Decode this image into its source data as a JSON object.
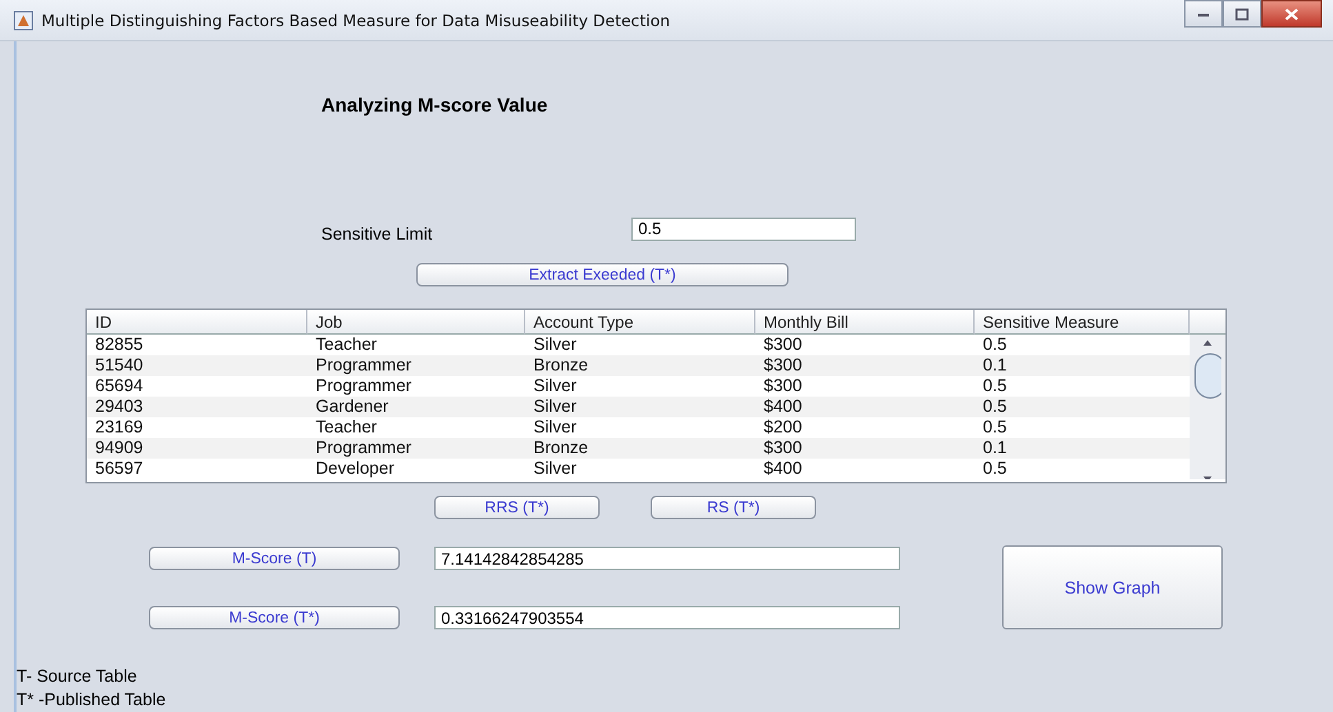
{
  "window": {
    "title": "Multiple Distinguishing Factors Based Measure for Data Misuseability Detection"
  },
  "heading": "Analyzing M-score Value",
  "sensitive_limit": {
    "label": "Sensitive Limit",
    "value": "0.5"
  },
  "extract_button": "Extract Exeeded (T*)",
  "table": {
    "columns": [
      "ID",
      "Job",
      "Account Type",
      "Monthly Bill",
      "Sensitive Measure"
    ],
    "rows": [
      [
        "82855",
        "Teacher",
        "Silver",
        "$300",
        "0.5"
      ],
      [
        "51540",
        "Programmer",
        "Bronze",
        "$300",
        "0.1"
      ],
      [
        "65694",
        "Programmer",
        "Silver",
        "$300",
        "0.5"
      ],
      [
        "29403",
        "Gardener",
        "Silver",
        "$400",
        "0.5"
      ],
      [
        "23169",
        "Teacher",
        "Silver",
        "$200",
        "0.5"
      ],
      [
        "94909",
        "Programmer",
        "Bronze",
        "$300",
        "0.1"
      ],
      [
        "56597",
        "Developer",
        "Silver",
        "$400",
        "0.5"
      ]
    ]
  },
  "rs_buttons": [
    "RRS (T*)",
    "RS (T*)"
  ],
  "scores": [
    {
      "button": "M-Score (T)",
      "value": "7.14142842854285"
    },
    {
      "button": "M-Score (T*)",
      "value": "0.33166247903554"
    }
  ],
  "graph_button": "Show Graph",
  "legend": [
    "T- Source Table",
    "T* -Published Table"
  ]
}
